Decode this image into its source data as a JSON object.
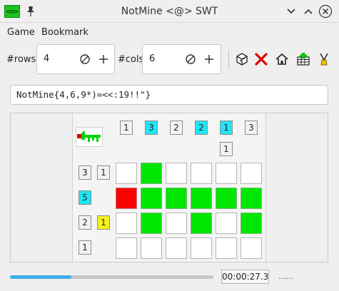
{
  "window": {
    "title": "NotMine <@> SWT",
    "app_icon_text": "<n>"
  },
  "menu": {
    "items": [
      "Game",
      "Bookmark"
    ]
  },
  "toolbar": {
    "rows_label": "#rows",
    "rows_value": "4",
    "cols_label": "#cols",
    "cols_value": "6",
    "icons": [
      "cube-icon",
      "red-x-icon",
      "home-icon",
      "grid-plus-icon",
      "broom-icon"
    ]
  },
  "expression": "NotMine{4,6,9*)=<<:19!!\"}",
  "board": {
    "column_clues": [
      [
        "1"
      ],
      [
        "3"
      ],
      [
        "2"
      ],
      [
        "2"
      ],
      [
        "1",
        "1"
      ],
      [
        "3"
      ]
    ],
    "row_clues": [
      [
        "3",
        "1"
      ],
      [
        "5"
      ],
      [
        "2",
        "1"
      ],
      [
        "1"
      ]
    ],
    "cells": [
      [
        "empty",
        "mine",
        "empty",
        "empty",
        "empty",
        "empty"
      ],
      [
        "flag",
        "mine",
        "mine",
        "mine",
        "mine",
        "mine"
      ],
      [
        "empty",
        "mine",
        "empty",
        "mine",
        "empty",
        "mine"
      ],
      [
        "empty",
        "empty",
        "empty",
        "empty",
        "empty",
        "empty"
      ]
    ],
    "colors": {
      "mine": "#00e600",
      "flag": "#ff0000",
      "cyan_clue": "#22e4f2",
      "yellow_clue": "#f6f11a"
    }
  },
  "status": {
    "progress": 0.3,
    "timer": "00:00:27.3",
    "dots": "......"
  }
}
